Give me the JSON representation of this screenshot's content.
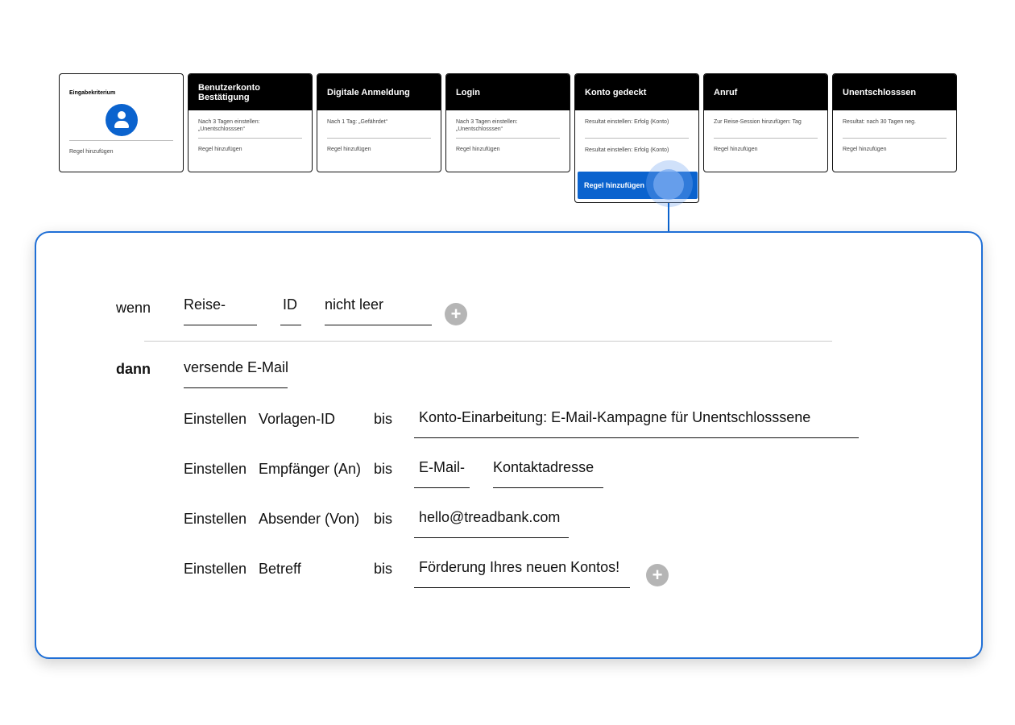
{
  "stages": [
    {
      "title": "Eingabekriterium",
      "add_rule": "Regel hinzufügen"
    },
    {
      "title": "Benutzerkonto Bestätigung",
      "lines": [
        "Nach 3 Tagen einstellen: „Unentschlosssen“"
      ],
      "add_rule": "Regel hinzufügen"
    },
    {
      "title": "Digitale Anmeldung",
      "lines": [
        "Nach 1 Tag: „Gefährdet“"
      ],
      "add_rule": "Regel hinzufügen"
    },
    {
      "title": "Login",
      "lines": [
        "Nach 3 Tagen einstellen: „Unentschlosssen“"
      ],
      "add_rule": "Regel hinzufügen"
    },
    {
      "title": "Konto gedeckt",
      "lines": [
        "Resultat einstellen: Erfolg (Konto)",
        "Resultat einstellen: Erfolg (Konto)"
      ],
      "add_rule": "Regel hinzufügen"
    },
    {
      "title": "Anruf",
      "lines": [
        "Zur Reise-Session hinzufügen: Tag"
      ],
      "add_rule": "Regel hinzufügen"
    },
    {
      "title": "Unentschlosssen",
      "lines": [
        "Resultat: nach 30 Tagen neg."
      ],
      "add_rule": "Regel hinzufügen"
    }
  ],
  "rule": {
    "if_label": "wenn",
    "condition": {
      "field1": "Reise-",
      "field2": "ID",
      "operator": "nicht leer"
    },
    "then_label": "dann",
    "action": "versende E-Mail",
    "set_label": "Einstellen",
    "to_label": "bis",
    "settings": [
      {
        "param": "Vorlagen-ID",
        "value": "Konto-Einarbeitung: E-Mail-Kampagne für Unentschlosssene"
      },
      {
        "param": "Empfänger (An)",
        "value": "E-Mail-",
        "value2": "Kontaktadresse"
      },
      {
        "param": "Absender (Von)",
        "value": "hello@treadbank.com"
      },
      {
        "param": "Betreff",
        "value": "Förderung Ihres neuen Kontos!"
      }
    ],
    "add_icon": "plus-icon"
  },
  "colors": {
    "accent": "#0b63ce",
    "panel_border": "#1f6fd6",
    "header_bg": "#000000"
  }
}
